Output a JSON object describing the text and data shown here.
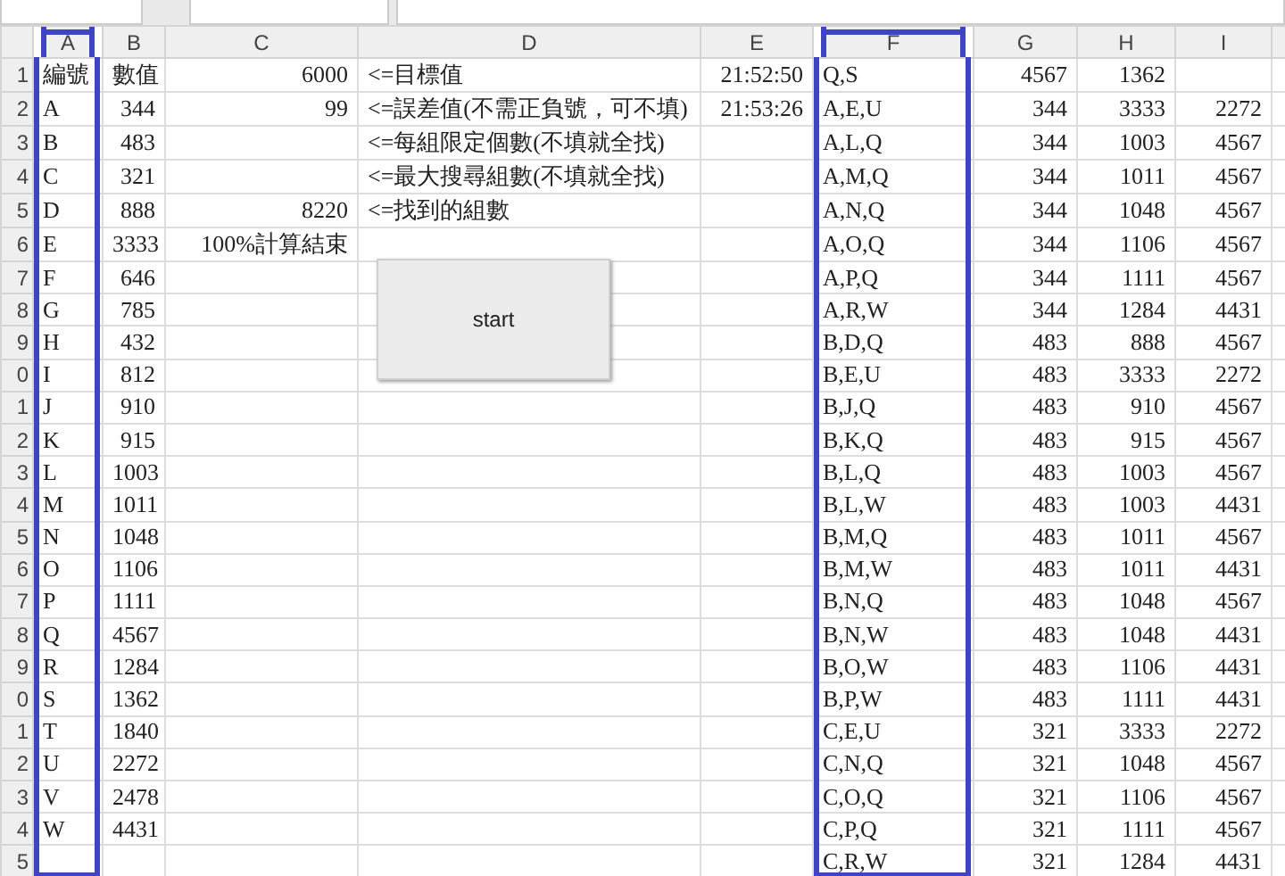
{
  "columns": [
    {
      "label": "A",
      "outlined": true
    },
    {
      "label": "B",
      "outlined": false
    },
    {
      "label": "C",
      "outlined": false
    },
    {
      "label": "D",
      "outlined": false
    },
    {
      "label": "E",
      "outlined": false
    },
    {
      "label": "F",
      "outlined": true
    },
    {
      "label": "G",
      "outlined": false
    },
    {
      "label": "H",
      "outlined": false
    },
    {
      "label": "I",
      "outlined": false
    }
  ],
  "rows": [
    {
      "number": "1",
      "cells": [
        "編號",
        "數值",
        "6000",
        "<=目標值",
        "21:52:50",
        "Q,S",
        "4567",
        "1362",
        null
      ]
    },
    {
      "number": "2",
      "cells": [
        "A",
        "344",
        "99",
        "<=誤差值(不需正負號，可不填)",
        "21:53:26",
        "A,E,U",
        "344",
        "3333",
        "2272"
      ]
    },
    {
      "number": "3",
      "cells": [
        "B",
        "483",
        null,
        "<=每組限定個數(不填就全找)",
        null,
        "A,L,Q",
        "344",
        "1003",
        "4567"
      ]
    },
    {
      "number": "4",
      "cells": [
        "C",
        "321",
        null,
        "<=最大搜尋組數(不填就全找)",
        null,
        "A,M,Q",
        "344",
        "1011",
        "4567"
      ]
    },
    {
      "number": "5",
      "cells": [
        "D",
        "888",
        "8220",
        "<=找到的組數",
        null,
        "A,N,Q",
        "344",
        "1048",
        "4567"
      ]
    },
    {
      "number": "6",
      "cells": [
        "E",
        "3333",
        "100%計算結束",
        null,
        null,
        "A,O,Q",
        "344",
        "1106",
        "4567"
      ]
    },
    {
      "number": "7",
      "cells": [
        "F",
        "646",
        null,
        null,
        null,
        "A,P,Q",
        "344",
        "1111",
        "4567"
      ]
    },
    {
      "number": "8",
      "cells": [
        "G",
        "785",
        null,
        null,
        null,
        "A,R,W",
        "344",
        "1284",
        "4431"
      ]
    },
    {
      "number": "9",
      "cells": [
        "H",
        "432",
        null,
        null,
        null,
        "B,D,Q",
        "483",
        "888",
        "4567"
      ]
    },
    {
      "number": "0",
      "cells": [
        "I",
        "812",
        null,
        null,
        null,
        "B,E,U",
        "483",
        "3333",
        "2272"
      ]
    },
    {
      "number": "1",
      "cells": [
        "J",
        "910",
        null,
        null,
        null,
        "B,J,Q",
        "483",
        "910",
        "4567"
      ]
    },
    {
      "number": "2",
      "cells": [
        "K",
        "915",
        null,
        null,
        null,
        "B,K,Q",
        "483",
        "915",
        "4567"
      ]
    },
    {
      "number": "3",
      "cells": [
        "L",
        "1003",
        null,
        null,
        null,
        "B,L,Q",
        "483",
        "1003",
        "4567"
      ]
    },
    {
      "number": "4",
      "cells": [
        "M",
        "1011",
        null,
        null,
        null,
        "B,L,W",
        "483",
        "1003",
        "4431"
      ]
    },
    {
      "number": "5",
      "cells": [
        "N",
        "1048",
        null,
        null,
        null,
        "B,M,Q",
        "483",
        "1011",
        "4567"
      ]
    },
    {
      "number": "6",
      "cells": [
        "O",
        "1106",
        null,
        null,
        null,
        "B,M,W",
        "483",
        "1011",
        "4431"
      ]
    },
    {
      "number": "7",
      "cells": [
        "P",
        "1111",
        null,
        null,
        null,
        "B,N,Q",
        "483",
        "1048",
        "4567"
      ]
    },
    {
      "number": "8",
      "cells": [
        "Q",
        "4567",
        null,
        null,
        null,
        "B,N,W",
        "483",
        "1048",
        "4431"
      ]
    },
    {
      "number": "9",
      "cells": [
        "R",
        "1284",
        null,
        null,
        null,
        "B,O,W",
        "483",
        "1106",
        "4431"
      ]
    },
    {
      "number": "0",
      "cells": [
        "S",
        "1362",
        null,
        null,
        null,
        "B,P,W",
        "483",
        "1111",
        "4431"
      ]
    },
    {
      "number": "1",
      "cells": [
        "T",
        "1840",
        null,
        null,
        null,
        "C,E,U",
        "321",
        "3333",
        "2272"
      ]
    },
    {
      "number": "2",
      "cells": [
        "U",
        "2272",
        null,
        null,
        null,
        "C,N,Q",
        "321",
        "1048",
        "4567"
      ]
    },
    {
      "number": "3",
      "cells": [
        "V",
        "2478",
        null,
        null,
        null,
        "C,O,Q",
        "321",
        "1106",
        "4567"
      ]
    },
    {
      "number": "4",
      "cells": [
        "W",
        "4431",
        null,
        null,
        null,
        "C,P,Q",
        "321",
        "1111",
        "4567"
      ]
    },
    {
      "number": "5",
      "cells": [
        null,
        null,
        null,
        null,
        null,
        "C,R,W",
        "321",
        "1284",
        "4431"
      ]
    }
  ],
  "button": {
    "label": "start"
  }
}
